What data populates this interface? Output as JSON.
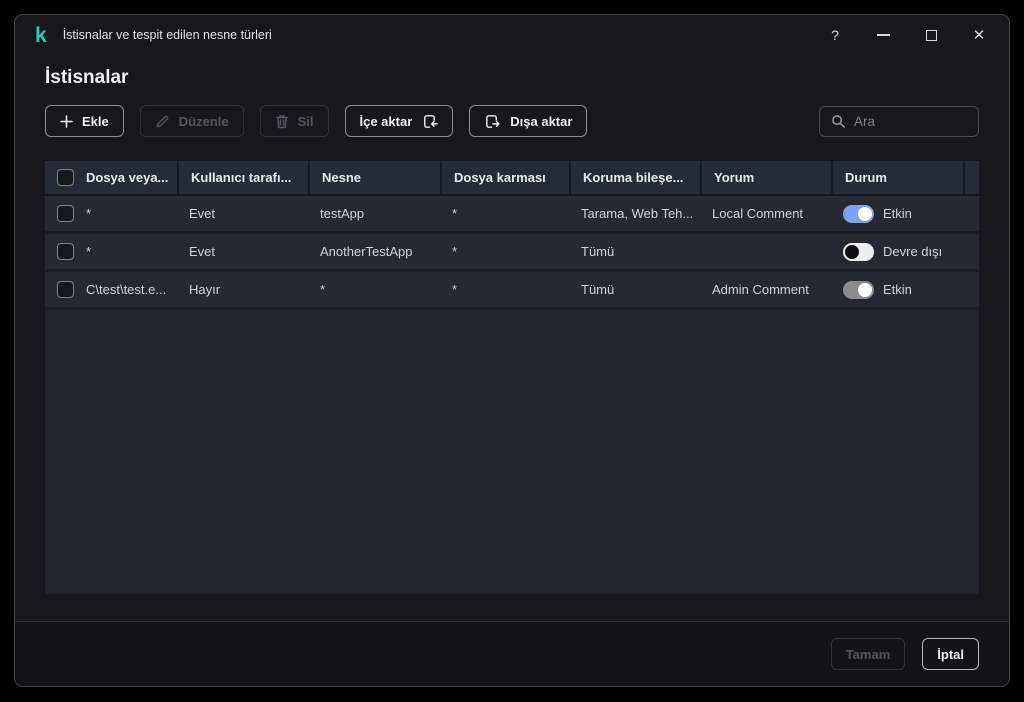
{
  "window": {
    "logo_glyph": "k",
    "title": "İstisnalar ve tespit edilen nesne türleri",
    "help_glyph": "?"
  },
  "page": {
    "title": "İstisnalar"
  },
  "toolbar": {
    "add_label": "Ekle",
    "edit_label": "Düzenle",
    "delete_label": "Sil",
    "import_label": "İçe aktar",
    "export_label": "Dışa aktar",
    "search_placeholder": "Ara",
    "search_value": ""
  },
  "table": {
    "columns": {
      "file": "Dosya veya...",
      "user": "Kullanıcı tarafı...",
      "object": "Nesne",
      "hash": "Dosya karması",
      "component": "Koruma bileşe...",
      "comment": "Yorum",
      "status": "Durum"
    },
    "rows": [
      {
        "file": "*",
        "user": "Evet",
        "object": "testApp",
        "hash": "*",
        "component": "Tarama, Web Teh...",
        "comment": "Local Comment",
        "status_label": "Etkin",
        "toggle": "on"
      },
      {
        "file": "*",
        "user": "Evet",
        "object": "AnotherTestApp",
        "hash": "*",
        "component": "Tümü",
        "comment": "",
        "status_label": "Devre dışı",
        "toggle": "off"
      },
      {
        "file": "C\\test\\test.e...",
        "user": "Hayır",
        "object": "*",
        "hash": "*",
        "component": "Tümü",
        "comment": "Admin Comment",
        "status_label": "Etkin",
        "toggle": "on-disabled"
      }
    ]
  },
  "footer": {
    "ok_label": "Tamam",
    "cancel_label": "İptal"
  },
  "colors": {
    "brand": "#23d1ae",
    "toggle_on": "#7ba3f1",
    "toggle_off": "#ecedef",
    "toggle_disabled": "#8a8a90",
    "window_bg": "#17171c",
    "table_bg": "#22242d",
    "header_bg": "#272b37",
    "row_bg": "#262932"
  }
}
